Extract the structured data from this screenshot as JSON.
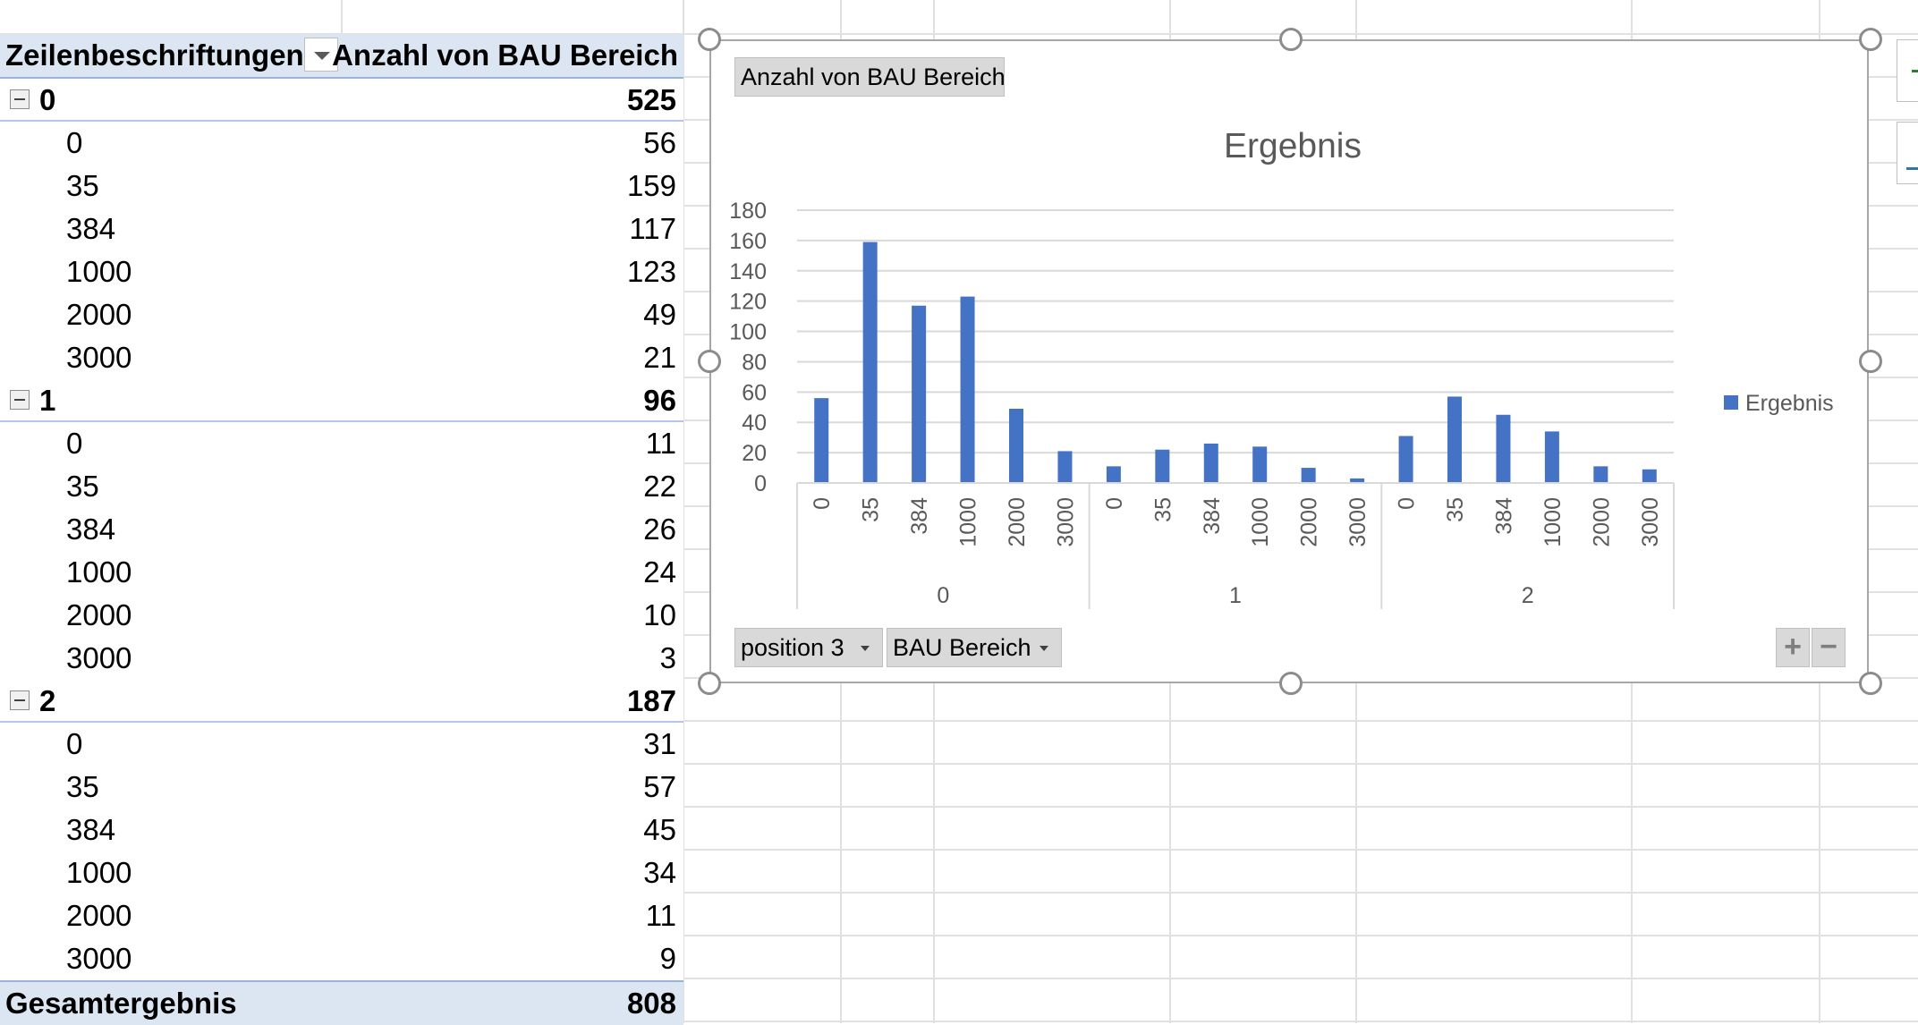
{
  "pivot": {
    "header_row_label": "Zeilenbeschriftungen",
    "header_value_label": "Anzahl von BAU Bereich",
    "groups": [
      {
        "label": "0",
        "total": "525",
        "items": [
          {
            "label": "0",
            "value": "56"
          },
          {
            "label": "35",
            "value": "159"
          },
          {
            "label": "384",
            "value": "117"
          },
          {
            "label": "1000",
            "value": "123"
          },
          {
            "label": "2000",
            "value": "49"
          },
          {
            "label": "3000",
            "value": "21"
          }
        ]
      },
      {
        "label": "1",
        "total": "96",
        "items": [
          {
            "label": "0",
            "value": "11"
          },
          {
            "label": "35",
            "value": "22"
          },
          {
            "label": "384",
            "value": "26"
          },
          {
            "label": "1000",
            "value": "24"
          },
          {
            "label": "2000",
            "value": "10"
          },
          {
            "label": "3000",
            "value": "3"
          }
        ]
      },
      {
        "label": "2",
        "total": "187",
        "items": [
          {
            "label": "0",
            "value": "31"
          },
          {
            "label": "35",
            "value": "57"
          },
          {
            "label": "384",
            "value": "45"
          },
          {
            "label": "1000",
            "value": "34"
          },
          {
            "label": "2000",
            "value": "11"
          },
          {
            "label": "3000",
            "value": "9"
          }
        ]
      }
    ],
    "grand_total_label": "Gesamtergebnis",
    "grand_total_value": "808"
  },
  "chart_buttons": {
    "value_field": "Anzahl von BAU Bereich",
    "axis_field_1": "position 3",
    "axis_field_2": "BAU Bereich",
    "expand": "+",
    "collapse": "−"
  },
  "chart_data": {
    "type": "bar",
    "title": "Ergebnis",
    "xlabel": "",
    "ylabel": "",
    "ylim": [
      0,
      180
    ],
    "yticks": [
      0,
      20,
      40,
      60,
      80,
      100,
      120,
      140,
      160,
      180
    ],
    "grid": true,
    "legend_position": "right",
    "groups": [
      "0",
      "1",
      "2"
    ],
    "categories": [
      "0",
      "35",
      "384",
      "1000",
      "2000",
      "3000"
    ],
    "series": [
      {
        "name": "Ergebnis",
        "color": "#4472c4",
        "values": [
          56,
          159,
          117,
          123,
          49,
          21,
          11,
          22,
          26,
          24,
          10,
          3,
          31,
          57,
          45,
          34,
          11,
          9
        ]
      }
    ]
  }
}
